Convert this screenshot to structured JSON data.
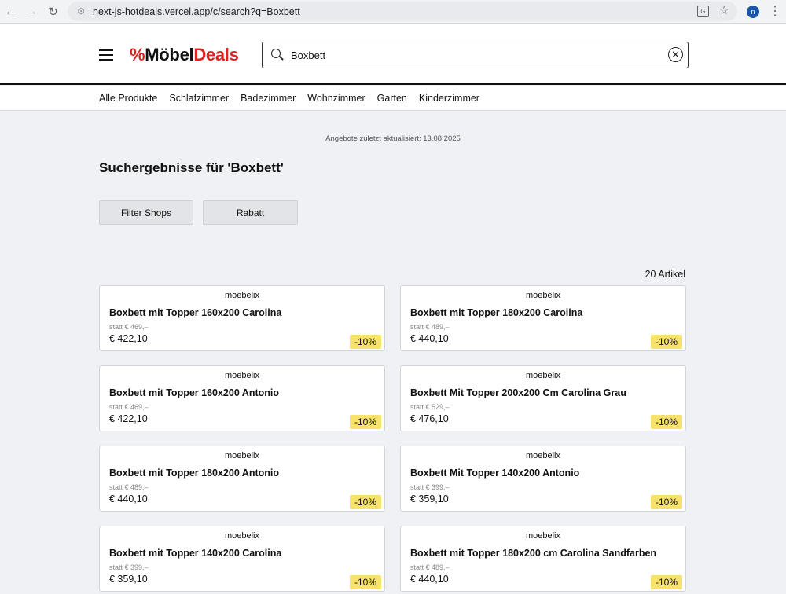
{
  "browser": {
    "url": "next-js-hotdeals.vercel.app/c/search?q=Boxbett",
    "profile_initial": "n"
  },
  "header": {
    "logo_pct": "%",
    "logo_moebel": "Möbel",
    "logo_deals": "Deals",
    "search_value": "Boxbett"
  },
  "nav": {
    "items": [
      "Alle Produkte",
      "Schlafzimmer",
      "Badezimmer",
      "Wohnzimmer",
      "Garten",
      "Kinderzimmer"
    ]
  },
  "main": {
    "updated": "Angebote zuletzt aktualisiert: 13.08.2025",
    "title": "Suchergebnisse für 'Boxbett'",
    "filter_shops": "Filter Shops",
    "filter_rabatt": "Rabatt",
    "count": "20 Artikel"
  },
  "products": [
    {
      "shop": "moebelix",
      "name": "Boxbett mit Topper 160x200 Carolina",
      "old": "statt € 469,–",
      "price": "€ 422,10",
      "discount": "-10%"
    },
    {
      "shop": "moebelix",
      "name": "Boxbett mit Topper 180x200 Carolina",
      "old": "statt € 489,–",
      "price": "€ 440,10",
      "discount": "-10%"
    },
    {
      "shop": "moebelix",
      "name": "Boxbett mit Topper 160x200 Antonio",
      "old": "statt € 469,–",
      "price": "€ 422,10",
      "discount": "-10%"
    },
    {
      "shop": "moebelix",
      "name": "Boxbett Mit Topper 200x200 Cm Carolina Grau",
      "old": "statt € 529,–",
      "price": "€ 476,10",
      "discount": "-10%"
    },
    {
      "shop": "moebelix",
      "name": "Boxbett mit Topper 180x200 Antonio",
      "old": "statt € 489,–",
      "price": "€ 440,10",
      "discount": "-10%"
    },
    {
      "shop": "moebelix",
      "name": "Boxbett Mit Topper 140x200 Antonio",
      "old": "statt € 399,–",
      "price": "€ 359,10",
      "discount": "-10%"
    },
    {
      "shop": "moebelix",
      "name": "Boxbett mit Topper 140x200 Carolina",
      "old": "statt € 399,–",
      "price": "€ 359,10",
      "discount": "-10%"
    },
    {
      "shop": "moebelix",
      "name": "Boxbett mit Topper 180x200 cm Carolina Sandfarben",
      "old": "statt € 489,–",
      "price": "€ 440,10",
      "discount": "-10%"
    }
  ]
}
